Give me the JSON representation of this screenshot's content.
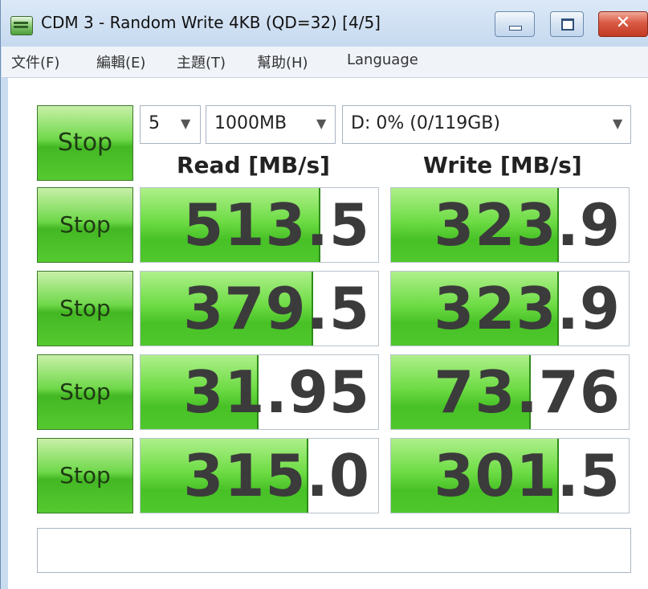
{
  "window": {
    "title": "CDM 3 - Random Write 4KB (QD=32) [4/5]",
    "close_glyph": "✕"
  },
  "menu": [
    "文件(F)",
    "編輯(E)",
    "主題(T)",
    "幫助(H)",
    "Language"
  ],
  "controls": {
    "stop_all_label": "Stop",
    "count_value": "5",
    "size_value": "1000MB",
    "drive_value": "D: 0% (0/119GB)",
    "arrow_glyph": "▼"
  },
  "headers": {
    "read": "Read [MB/s]",
    "write": "Write [MB/s]"
  },
  "rows": [
    {
      "stop_label": "Stop",
      "read": "513.5",
      "write": "323.9",
      "read_fill": 0.75,
      "write_fill": 0.7
    },
    {
      "stop_label": "Stop",
      "read": "379.5",
      "write": "323.9",
      "read_fill": 0.72,
      "write_fill": 0.7
    },
    {
      "stop_label": "Stop",
      "read": "31.95",
      "write": "73.76",
      "read_fill": 0.49,
      "write_fill": 0.58
    },
    {
      "stop_label": "Stop",
      "read": "315.0",
      "write": "301.5",
      "read_fill": 0.7,
      "write_fill": 0.7
    }
  ],
  "comment": "",
  "colors": {
    "accent_green": "#47c126",
    "value_text": "#3b3b3b",
    "close_red": "#c23a24"
  },
  "icons": [
    "app-icon",
    "minimize-icon",
    "maximize-icon",
    "close-icon",
    "chevron-down-icon"
  ]
}
